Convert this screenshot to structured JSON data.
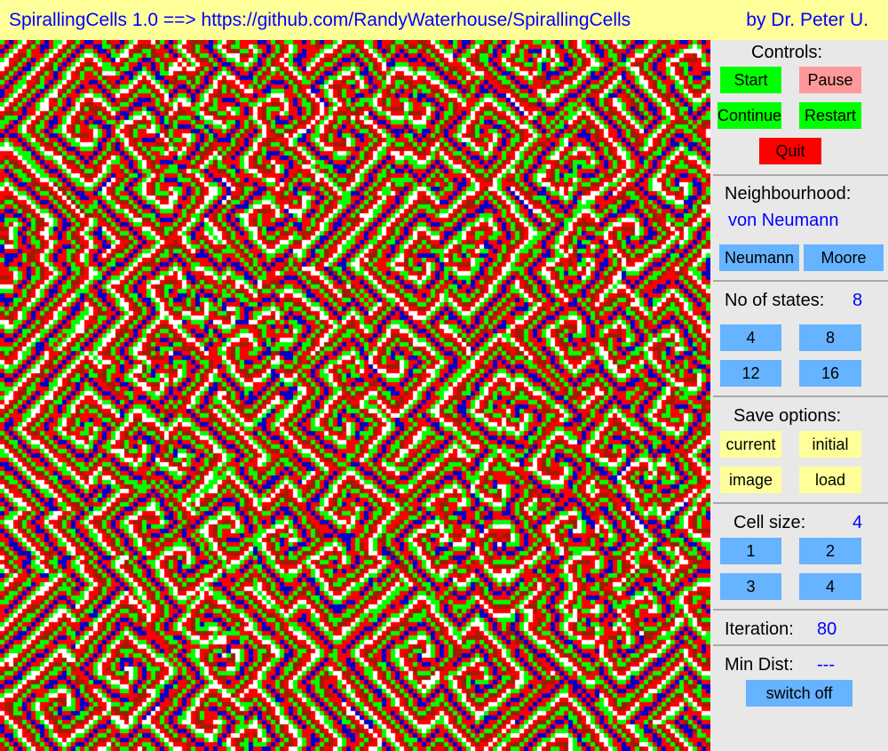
{
  "title": {
    "left": "SpirallingCells 1.0 ==> https://github.com/RandyWaterhouse/SpirallingCells",
    "right": "by Dr. Peter U."
  },
  "colors": {
    "title_bg": "#ffff99",
    "title_text": "#0000ff",
    "panel_bg": "#e8e8e8",
    "state_palette": [
      "#ff0000",
      "#ffffff",
      "#00ff00",
      "#ff0000",
      "#0000cc",
      "#ff0000",
      "#00ff00",
      "#a01c00"
    ]
  },
  "controls": {
    "header": "Controls:",
    "start": "Start",
    "pause": "Pause",
    "continue": "Continue",
    "restart": "Restart",
    "quit": "Quit"
  },
  "neighbourhood": {
    "header": "Neighbourhood:",
    "value": "von Neumann",
    "neumann": "Neumann",
    "moore": "Moore"
  },
  "states": {
    "header": "No of states:",
    "value": "8",
    "options": [
      "4",
      "8",
      "12",
      "16"
    ]
  },
  "save": {
    "header": "Save options:",
    "current": "current",
    "initial": "initial",
    "image": "image",
    "load": "load"
  },
  "cellsize": {
    "header": "Cell size:",
    "value": "4",
    "options": [
      "1",
      "2",
      "3",
      "4"
    ]
  },
  "iteration": {
    "label": "Iteration:",
    "value": "80"
  },
  "mindist": {
    "label": "Min Dist:",
    "value": "---",
    "switch": "switch off"
  }
}
